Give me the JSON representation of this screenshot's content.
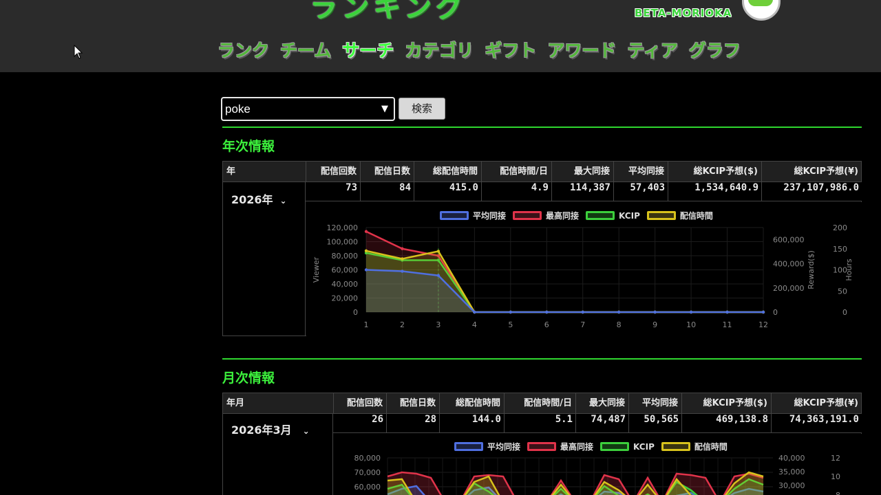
{
  "header": {
    "logo_text": "ランキング",
    "logo_sub": "BETA-MORIOKA",
    "nav": [
      "ランク",
      "チーム",
      "サーチ",
      "カテゴリ",
      "ギフト",
      "アワード",
      "ティア",
      "グラフ"
    ],
    "active_nav": "サーチ"
  },
  "search": {
    "value": "poke",
    "button_label": "検索"
  },
  "yearly": {
    "title": "年次情報",
    "header_first": "年",
    "columns": [
      "配信回数",
      "配信日数",
      "総配信時間",
      "配信時間/日",
      "最大同接",
      "平均同接",
      "総KCIP予想($)",
      "総KCIP予想(¥)"
    ],
    "selected": "2026年",
    "values": [
      "73",
      "84",
      "415.0",
      "4.9",
      "114,387",
      "57,403",
      "1,534,640.9",
      "237,107,986.0"
    ]
  },
  "monthly": {
    "title": "月次情報",
    "header_first": "年月",
    "columns": [
      "配信回数",
      "配信日数",
      "総配信時間",
      "配信時間/日",
      "最大同接",
      "平均同接",
      "総KCIP予想($)",
      "総KCIP予想(¥)"
    ],
    "selected": "2026年3月",
    "values": [
      "26",
      "28",
      "144.0",
      "5.1",
      "74,487",
      "50,565",
      "469,138.8",
      "74,363,191.0"
    ]
  },
  "colors": {
    "avg": "#4f6fe0",
    "max": "#e0334a",
    "kcip": "#3ccf3c",
    "hours": "#d8c21c",
    "accent": "#2fd82f"
  },
  "chart_data": [
    {
      "type": "line",
      "legend": [
        "平均同接",
        "最高同接",
        "KCIP",
        "配信時間"
      ],
      "x": [
        1,
        2,
        3,
        4,
        5,
        6,
        7,
        8,
        9,
        10,
        11,
        12
      ],
      "ylabel": "Viewer",
      "y2label": "Reward($)",
      "y3label": "Hours",
      "y_ticks": [
        "0",
        "20,000",
        "40,000",
        "60,000",
        "80,000",
        "100,000",
        "120,000"
      ],
      "y2_ticks": [
        "0",
        "200,000",
        "400,000",
        "600,000"
      ],
      "y3_ticks": [
        "0",
        "50",
        "100",
        "150",
        "200"
      ],
      "ylim": [
        0,
        120000
      ],
      "y2lim": [
        0,
        600000
      ],
      "y3lim": [
        0,
        200
      ],
      "series": [
        {
          "name": "平均同接",
          "axis": "y",
          "values": [
            60000,
            58000,
            52000,
            0,
            0,
            0,
            0,
            0,
            0,
            0,
            0,
            0
          ]
        },
        {
          "name": "最高同接",
          "axis": "y",
          "values": [
            114387,
            90000,
            80000,
            0,
            0,
            0,
            0,
            0,
            0,
            0,
            0,
            0
          ]
        },
        {
          "name": "KCIP",
          "axis": "y2",
          "values": [
            490000,
            430000,
            430000,
            0,
            0,
            0,
            0,
            0,
            0,
            0,
            0,
            0
          ]
        },
        {
          "name": "配信時間",
          "axis": "y3",
          "values": [
            145,
            126,
            144,
            0,
            0,
            0,
            0,
            0,
            0,
            0,
            0,
            0
          ]
        }
      ]
    },
    {
      "type": "line",
      "legend": [
        "平均同接",
        "最高同接",
        "KCIP",
        "配信時間"
      ],
      "y_ticks": [
        "60,000",
        "70,000",
        "80,000"
      ],
      "y2_ticks": [
        "30,000",
        "35,000",
        "40,000"
      ],
      "y3_ticks": [
        "8",
        "10",
        "12"
      ],
      "ylim": [
        50000,
        80000
      ],
      "y2lim": [
        25000,
        40000
      ],
      "y3lim": [
        6,
        12
      ]
    }
  ]
}
